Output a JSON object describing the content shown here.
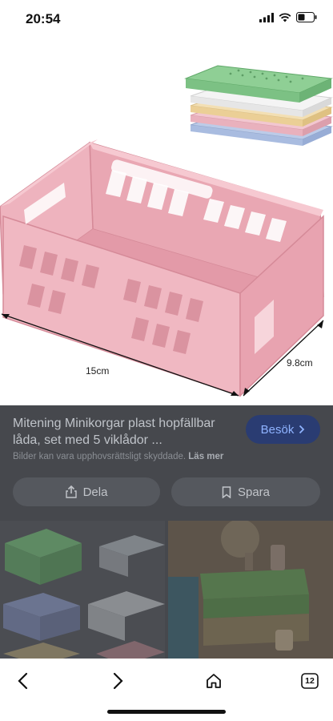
{
  "status_bar": {
    "time": "20:54"
  },
  "image": {
    "dim_width": "15cm",
    "dim_height": "9.8cm"
  },
  "result": {
    "title": "Mitening Minikorgar plast hopfällbar låda, set med 5 viklådor ...",
    "visit_label": "Besök",
    "copyright_text": "Bilder kan vara upphovsrättsligt skyddade.",
    "learn_more": "Läs mer",
    "share_label": "Dela",
    "save_label": "Spara"
  },
  "nav": {
    "tab_count": "12"
  },
  "colors": {
    "crate_pink": "#e9a7b3",
    "crate_green": "#8fcf95",
    "overlay": "#46484d",
    "accent_button": "#2a3c72"
  },
  "icons": [
    "signal-icon",
    "wifi-icon",
    "battery-icon",
    "chevron-right-icon",
    "share-icon",
    "bookmark-icon",
    "back-icon",
    "forward-icon",
    "home-icon",
    "tabs-icon"
  ]
}
